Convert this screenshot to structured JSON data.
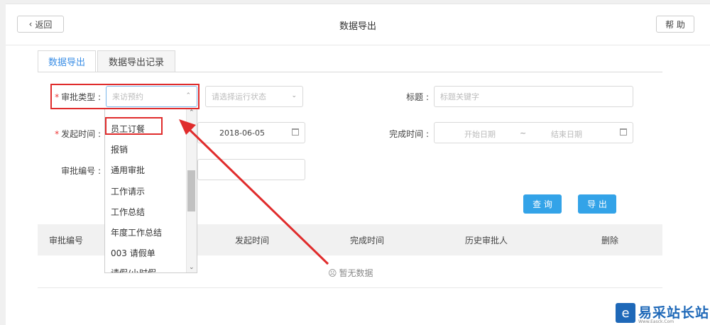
{
  "header": {
    "back_label": "返回",
    "title": "数据导出",
    "help_label": "帮 助"
  },
  "tabs": [
    {
      "label": "数据导出"
    },
    {
      "label": "数据导出记录"
    }
  ],
  "form": {
    "approval_type_label": "审批类型 :",
    "approval_type_value": "来访预约",
    "run_status_placeholder": "请选择运行状态",
    "title_label": "标题 :",
    "title_placeholder": "标题关键字",
    "start_time_label": "发起时间 :",
    "start_date_value": "2018-06-05",
    "complete_time_label": "完成时间 :",
    "start_date_placeholder": "开始日期",
    "range_sep": "~",
    "end_date_placeholder": "结束日期",
    "approval_no_label": "审批编号 :"
  },
  "actions": {
    "query_label": "查 询",
    "export_label": "导 出"
  },
  "table": {
    "columns": [
      "审批编号",
      "发起时间",
      "完成时间",
      "历史审批人",
      "删除"
    ],
    "empty_text": "暂无数据"
  },
  "dropdown": {
    "options": [
      "员工订餐",
      "报销",
      "通用审批",
      "工作请示",
      "工作总结",
      "年度工作总结",
      "003 请假单",
      "请假/小时假"
    ]
  },
  "watermark": {
    "text": "易采站长站",
    "subtext": "Www.Easck.Com"
  },
  "colors": {
    "accent": "#33a3e8",
    "highlight": "#e02c2c"
  }
}
